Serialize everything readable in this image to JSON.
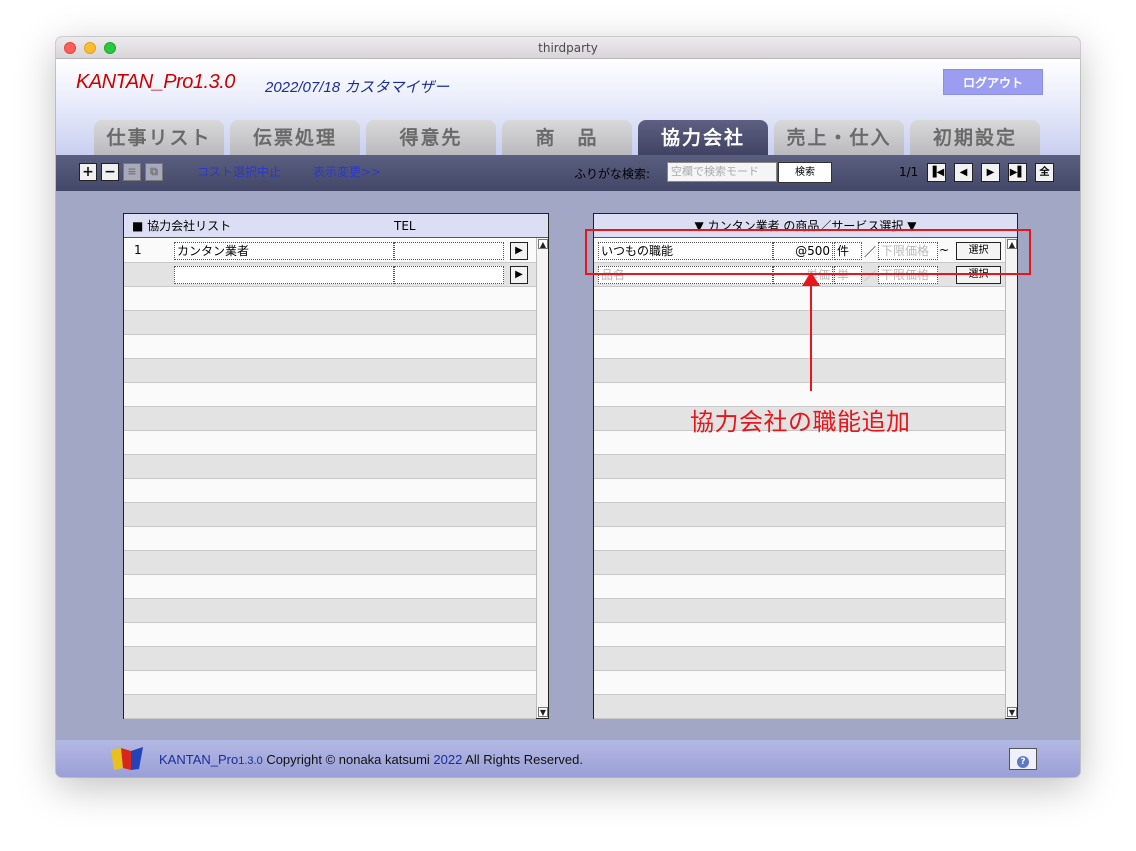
{
  "window": {
    "title": "thirdparty"
  },
  "header": {
    "app_name": "KANTAN_Pro1.3.0",
    "subtitle": "2022/07/18 カスタマイザー",
    "logout_label": "ログアウト"
  },
  "tabs": [
    {
      "label": "仕事リスト",
      "active": false
    },
    {
      "label": "伝票処理",
      "active": false
    },
    {
      "label": "得意先",
      "active": false
    },
    {
      "label": "商　品",
      "active": false
    },
    {
      "label": "協力会社",
      "active": true
    },
    {
      "label": "売上・仕入",
      "active": false
    },
    {
      "label": "初期設定",
      "active": false
    }
  ],
  "toolbar": {
    "add_label": "+",
    "remove_label": "−",
    "list_icon": "list-icon",
    "copy_icon": "copy-icon",
    "cost_cancel_label": "コスト選択中止",
    "display_change_label": "表示変更>>",
    "search_label": "ふりがな検索:",
    "search_placeholder": "空欄で検索モード",
    "search_button": "検索",
    "page_indicator": "1/1",
    "nav_first": "⏮",
    "nav_prev": "◀",
    "nav_next": "▶",
    "nav_last": "⏭",
    "all_label": "全"
  },
  "left_panel": {
    "header_title": "■ 協力会社リスト",
    "header_tel": "TEL",
    "rows": [
      {
        "number": "1",
        "name": "カンタン業者",
        "tel": ""
      },
      {
        "number": "",
        "name": "",
        "tel": ""
      }
    ]
  },
  "right_panel": {
    "header_title": "▼ カンタン業者 の商品／サービス選択 ▼",
    "rows": [
      {
        "name": "いつもの職能",
        "price": "@500",
        "unit": "件",
        "slash": "／",
        "lower_price": "下限価格",
        "tilde": "~",
        "select": "選択"
      },
      {
        "name": "品名",
        "price": "単価",
        "unit": "単",
        "slash": "／",
        "lower_price": "下限価格",
        "tilde": "~",
        "select": "選択"
      }
    ]
  },
  "annotation": {
    "text": "協力会社の職能追加",
    "color": "#e8151b"
  },
  "footer": {
    "brand": "KANTAN_Pro",
    "version": "1.3.0",
    "copyright": " Copyright © nonaka katsumi ",
    "year": "2022",
    "rights": " All Rights Reserved."
  }
}
